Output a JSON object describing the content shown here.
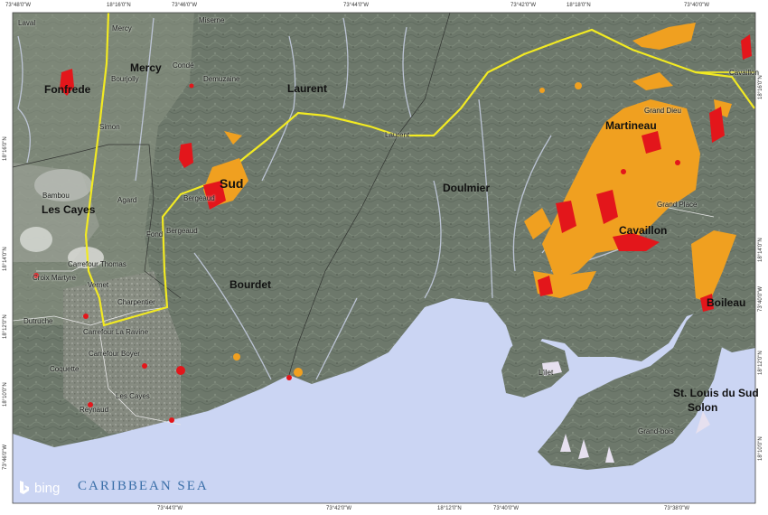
{
  "coords": {
    "top": [
      "73°48'0\"W",
      "18°16'0\"N",
      "73°46'0\"W",
      "73°44'0\"W",
      "73°42'0\"W",
      "18°18'0\"N",
      "73°40'0\"W"
    ],
    "bottom": [
      "73°44'0\"W",
      "73°42'0\"W",
      "18°12'0\"N",
      "73°40'0\"W",
      "73°38'0\"W"
    ],
    "left": [
      "18°16'0\"N",
      "18°14'0\"N",
      "18°12'0\"N",
      "18°10'0\"N",
      "73°46'0\"W"
    ],
    "right": [
      "18°16'0\"N",
      "18°14'0\"N",
      "73°40'0\"W",
      "18°12'0\"N",
      "18°10'0\"N"
    ]
  },
  "places": {
    "laval": "Laval",
    "mercy_small": "Mercy",
    "miserne": "Miserne",
    "mercy": "Mercy",
    "conde": "Condé",
    "bourjolly": "Bourjolly",
    "demuzaine": "Demuzaine",
    "fonfrede": "Fonfrede",
    "simon": "Simon",
    "laurent": "Laurent",
    "laurent_small": "Laurent",
    "cavaillon_small": "Cavaillon",
    "grand_dieu": "Grand Dieu",
    "martineau": "Martineau",
    "bambou": "Bambou",
    "les_cayes": "Les Cayes",
    "agard": "Agard",
    "bergeaud": "Bergeaud",
    "sud": "Sud",
    "fond": "Fond",
    "bergeaud2": "Bergeaud",
    "doulmier": "Doulmier",
    "grand_place": "Grand Place",
    "cavaillon": "Cavaillon",
    "carrefour_thomas": "Carrefour Thomas",
    "croix_martyre": "Croix Martyre",
    "vernet": "Vernet",
    "charpentier": "Charpentier",
    "bourdet": "Bourdet",
    "boileau": "Boileau",
    "dutruche": "Dutruche",
    "carrefour_la_ravine": "Carrefour La Ravine",
    "carrefour_boyer": "Carrefour Boyer",
    "coquette": "Coquette",
    "lilet": "L'ilet",
    "les_cayes_small": "Les Cayes",
    "st_louis": "St. Louis du Sud",
    "solon": "Solon",
    "reynaud": "Reynaud",
    "grand_bois": "Grand-bois"
  },
  "sea_label": "CARIBBEAN SEA",
  "attribution": "bing",
  "colors": {
    "land": "#6f7a6d",
    "sea": "#cbd5f3",
    "highway": "#f2ea22",
    "flood_orange": "#f0a020",
    "flood_red": "#e3161b"
  },
  "icons": [
    "bing-logo-icon"
  ]
}
